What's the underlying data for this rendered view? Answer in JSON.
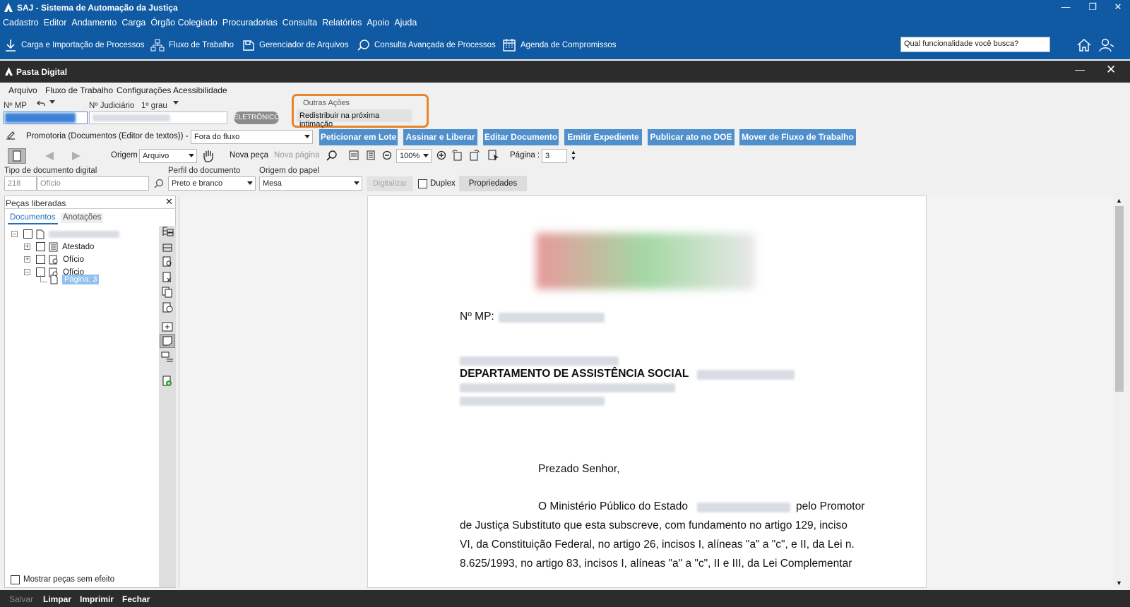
{
  "app": {
    "title": "SAJ - Sistema de Automação da Justiça",
    "menu": [
      "Cadastro",
      "Editor",
      "Andamento",
      "Carga",
      "Órgão Colegiado",
      "Procuradorias",
      "Consulta",
      "Relatórios",
      "Apoio",
      "Ajuda"
    ],
    "toolbar": [
      {
        "label": "Carga e Importação de Processos",
        "icon": "download-icon"
      },
      {
        "label": "Fluxo de Trabalho",
        "icon": "workflow-icon"
      },
      {
        "label": "Gerenciador de Arquivos",
        "icon": "file-manager-icon"
      },
      {
        "label": "Consulta Avançada de Processos",
        "icon": "advanced-search-icon"
      },
      {
        "label": "Agenda de Compromissos",
        "icon": "calendar-icon"
      }
    ],
    "search_placeholder": "Qual funcionalidade você busca?"
  },
  "window": {
    "title": "Pasta Digital",
    "menu": [
      "Arquivo",
      "Fluxo de Trabalho",
      "Configurações",
      "Acessibilidade"
    ],
    "fields": {
      "nmp_label": "Nº MP",
      "judiciario_label": "Nº Judiciário",
      "grau": "1º grau",
      "badge": "ELETRÔNICO"
    },
    "outras_acoes": {
      "title": "Outras Ações",
      "item": "Redistribuir na próxima intimação"
    },
    "fila_label": "Promotoria (Documentos (Editor de textos)) - Fila",
    "fila_value": "Fora do fluxo",
    "action_buttons": [
      "Peticionar em Lote",
      "Assinar e Liberar",
      "Editar Documento",
      "Emitir Expediente",
      "Publicar ato no DOE",
      "Mover de Fluxo de Trabalho"
    ],
    "viewer_toolbar": {
      "origem_label": "Origem",
      "origem_value": "Arquivo",
      "nova_peca": "Nova peça",
      "nova_pagina": "Nova página",
      "zoom": "100%",
      "pagina_label": "Página :",
      "pagina_value": "3"
    },
    "digital": {
      "tipo_label": "Tipo de documento digital",
      "tipo_code": "218",
      "tipo_value": "Ofício",
      "perfil_label": "Perfil do documento",
      "perfil_value": "Preto e branco",
      "origem_papel_label": "Origem do papel",
      "origem_papel_value": "Mesa",
      "digitalizar": "Digitalizar",
      "duplex": "Duplex",
      "propriedades": "Propriedades"
    },
    "left_panel": {
      "title": "Peças liberadas",
      "tabs": [
        "Documentos",
        "Anotações"
      ],
      "tree": [
        "Atestado",
        "Ofício",
        "Ofício",
        "Página: 3"
      ],
      "footer_checkbox": "Mostrar peças sem efeito"
    },
    "document": {
      "mp_label": "Nº MP:",
      "dept": "DEPARTAMENTO DE ASSISTÊNCIA SOCIAL",
      "greeting": "Prezado Senhor,",
      "para1_start": "O Ministério Público do Estado",
      "para1_end": "pelo Promotor",
      "line2": "de Justiça Substituto que esta subscreve, com fundamento no artigo 129, inciso",
      "line3": "VI, da Constituição Federal, no artigo 26, incisos I, alíneas \"a\" a \"c\", e II, da Lei n.",
      "line4": "8.625/1993, no artigo 83, incisos I, alíneas \"a\" a \"c\", II e III, da Lei Complementar"
    },
    "footer": [
      "Salvar",
      "Limpar",
      "Imprimir",
      "Fechar"
    ]
  },
  "colors": {
    "brand_blue": "#0f5aa3",
    "action_blue": "#4f8fcc",
    "highlight_orange": "#e8832a",
    "dark_bar": "#2c2c2c"
  }
}
